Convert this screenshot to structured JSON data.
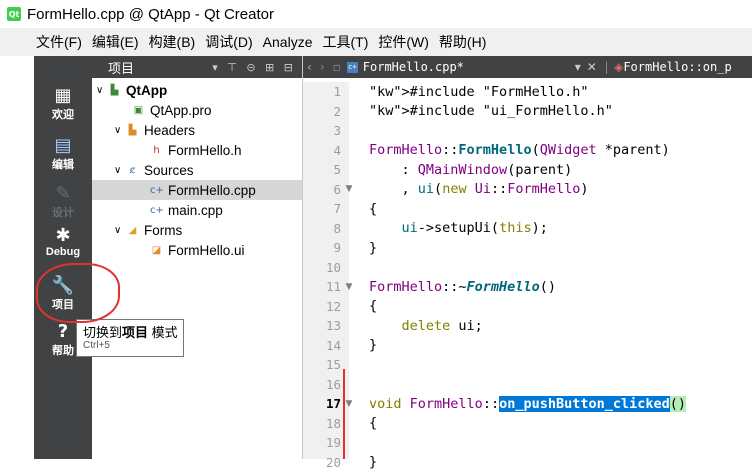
{
  "window": {
    "app_icon": "qt-creator-icon",
    "title": "FormHello.cpp @ QtApp - Qt Creator"
  },
  "menu": [
    "文件(F)",
    "编辑(E)",
    "构建(B)",
    "调试(D)",
    "Analyze",
    "工具(T)",
    "控件(W)",
    "帮助(H)"
  ],
  "modes": [
    {
      "label": "欢迎",
      "icon": "grid-icon"
    },
    {
      "label": "编辑",
      "icon": "document-icon"
    },
    {
      "label": "设计",
      "icon": "pencil-icon"
    },
    {
      "label": "Debug",
      "icon": "bug-icon"
    },
    {
      "label": "项目",
      "icon": "wrench-icon"
    },
    {
      "label": "帮助",
      "icon": "help-icon"
    }
  ],
  "project_panel": {
    "title": "项目",
    "tree": [
      {
        "label": "QtApp",
        "level": 0,
        "expanded": true,
        "bold": true
      },
      {
        "label": "QtApp.pro",
        "level": 1
      },
      {
        "label": "Headers",
        "level": 1,
        "expanded": true
      },
      {
        "label": "FormHello.h",
        "level": 2
      },
      {
        "label": "Sources",
        "level": 1,
        "expanded": true
      },
      {
        "label": "FormHello.cpp",
        "level": 2,
        "selected": true
      },
      {
        "label": "main.cpp",
        "level": 2
      },
      {
        "label": "Forms",
        "level": 1,
        "expanded": true
      },
      {
        "label": "FormHello.ui",
        "level": 2
      }
    ]
  },
  "editor": {
    "file_tab": "FormHello.cpp*",
    "symbol": "FormHello::on_p",
    "line_numbers": [
      "1",
      "2",
      "3",
      "4",
      "5",
      "6",
      "7",
      "8",
      "9",
      "10",
      "11",
      "12",
      "13",
      "14",
      "15",
      "16",
      "17",
      "18",
      "19",
      "20"
    ],
    "current_line": "17",
    "lines": [
      "#include \"FormHello.h\"",
      "#include \"ui_FormHello.h\"",
      "",
      "FormHello::FormHello(QWidget *parent)",
      "    : QMainWindow(parent)",
      "    , ui(new Ui::FormHello)",
      "{",
      "    ui->setupUi(this);",
      "}",
      "",
      "FormHello::~FormHello()",
      "{",
      "    delete ui;",
      "}",
      "",
      "",
      "void FormHello::on_pushButton_clicked()",
      "{",
      "",
      "}"
    ]
  },
  "tooltip": {
    "prefix": "切换到",
    "strong": "项目",
    "suffix": " 模式",
    "shortcut": "Ctrl+5"
  },
  "colors": {
    "mode_bar": "#404244",
    "annotation_red": "#e53030",
    "selection_blue": "#0078d7"
  }
}
